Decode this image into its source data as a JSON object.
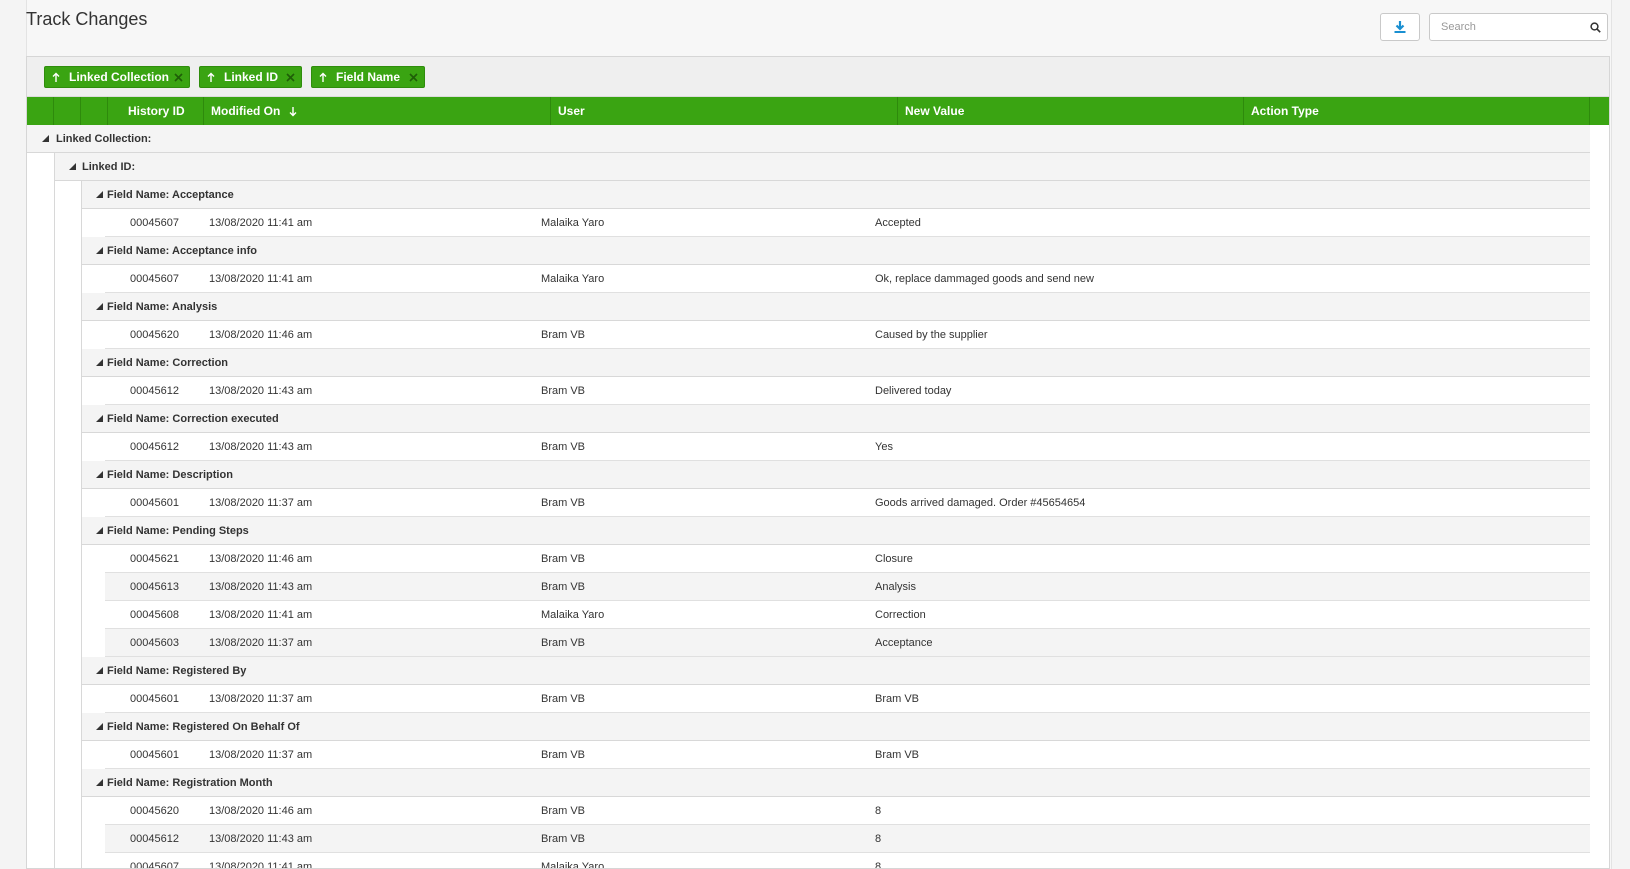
{
  "page": {
    "title": "Track Changes"
  },
  "toolbar": {
    "search_placeholder": "Search",
    "download_icon": "download-icon",
    "search_icon": "search-icon"
  },
  "group_chips": [
    {
      "label": "Linked Collection"
    },
    {
      "label": "Linked ID"
    },
    {
      "label": "Field Name"
    }
  ],
  "columns": {
    "history_id": "History ID",
    "modified_on": "Modified On",
    "user": "User",
    "new_value": "New Value",
    "action_type": "Action Type"
  },
  "groups": {
    "collection": "Linked Collection:",
    "linked_id": "Linked ID:"
  },
  "field_groups": [
    {
      "label": "Field Name: Acceptance",
      "rows": [
        {
          "id": "00045607",
          "date": "13/08/2020 11:41 am",
          "user": "Malaika Yaro",
          "value": "Accepted"
        }
      ]
    },
    {
      "label": "Field Name: Acceptance info",
      "rows": [
        {
          "id": "00045607",
          "date": "13/08/2020 11:41 am",
          "user": "Malaika Yaro",
          "value": "Ok, replace dammaged goods and send new"
        }
      ]
    },
    {
      "label": "Field Name: Analysis",
      "rows": [
        {
          "id": "00045620",
          "date": "13/08/2020 11:46 am",
          "user": "Bram VB",
          "value": "Caused by the supplier"
        }
      ]
    },
    {
      "label": "Field Name: Correction",
      "rows": [
        {
          "id": "00045612",
          "date": "13/08/2020 11:43 am",
          "user": "Bram VB",
          "value": "Delivered today"
        }
      ]
    },
    {
      "label": "Field Name: Correction executed",
      "rows": [
        {
          "id": "00045612",
          "date": "13/08/2020 11:43 am",
          "user": "Bram VB",
          "value": "Yes"
        }
      ]
    },
    {
      "label": "Field Name: Description",
      "rows": [
        {
          "id": "00045601",
          "date": "13/08/2020 11:37 am",
          "user": "Bram VB",
          "value": "Goods arrived damaged. Order #45654654"
        }
      ]
    },
    {
      "label": "Field Name: Pending Steps",
      "rows": [
        {
          "id": "00045621",
          "date": "13/08/2020 11:46 am",
          "user": "Bram VB",
          "value": "Closure"
        },
        {
          "id": "00045613",
          "date": "13/08/2020 11:43 am",
          "user": "Bram VB",
          "value": "Analysis"
        },
        {
          "id": "00045608",
          "date": "13/08/2020 11:41 am",
          "user": "Malaika Yaro",
          "value": "Correction"
        },
        {
          "id": "00045603",
          "date": "13/08/2020 11:37 am",
          "user": "Bram VB",
          "value": "Acceptance"
        }
      ]
    },
    {
      "label": "Field Name: Registered By",
      "rows": [
        {
          "id": "00045601",
          "date": "13/08/2020 11:37 am",
          "user": "Bram VB",
          "value": "Bram VB"
        }
      ]
    },
    {
      "label": "Field Name: Registered On Behalf Of",
      "rows": [
        {
          "id": "00045601",
          "date": "13/08/2020 11:37 am",
          "user": "Bram VB",
          "value": "Bram VB"
        }
      ]
    },
    {
      "label": "Field Name: Registration Month",
      "rows": [
        {
          "id": "00045620",
          "date": "13/08/2020 11:46 am",
          "user": "Bram VB",
          "value": "8"
        },
        {
          "id": "00045612",
          "date": "13/08/2020 11:43 am",
          "user": "Bram VB",
          "value": "8"
        },
        {
          "id": "00045607",
          "date": "13/08/2020 11:41 am",
          "user": "Malaika Yaro",
          "value": "8"
        }
      ]
    }
  ],
  "colors": {
    "accent": "#3aa412",
    "icon_blue": "#1a8fd1"
  }
}
